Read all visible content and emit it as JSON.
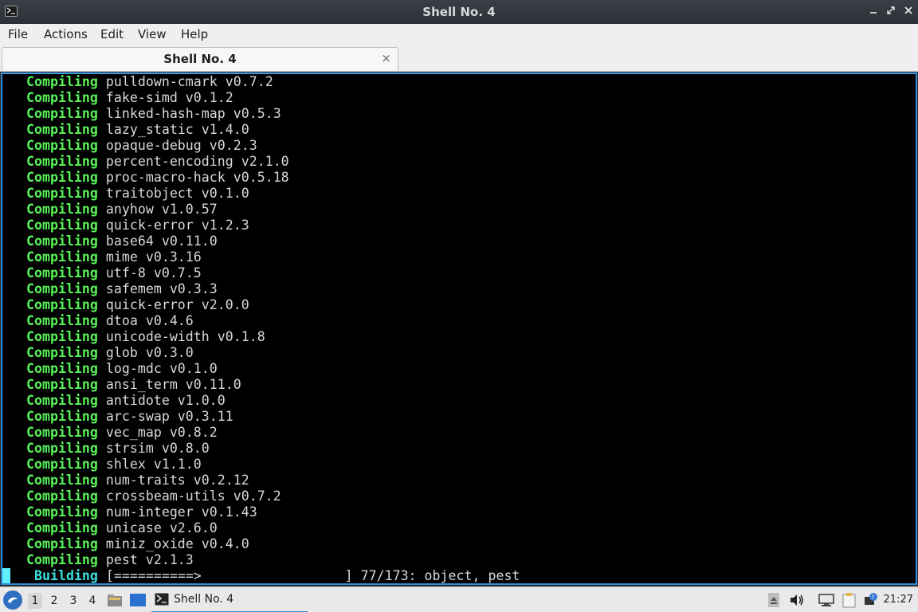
{
  "window": {
    "title": "Shell No. 4",
    "controls": [
      "minimize-icon",
      "restore-icon",
      "close-icon"
    ]
  },
  "menu": {
    "items": [
      "File",
      "Actions",
      "Edit",
      "View",
      "Help"
    ]
  },
  "tab": {
    "label": "Shell No. 4",
    "close": "×"
  },
  "terminal": {
    "keyword": "Compiling",
    "lines": [
      "pulldown-cmark v0.7.2",
      "fake-simd v0.1.2",
      "linked-hash-map v0.5.3",
      "lazy_static v1.4.0",
      "opaque-debug v0.2.3",
      "percent-encoding v2.1.0",
      "proc-macro-hack v0.5.18",
      "traitobject v0.1.0",
      "anyhow v1.0.57",
      "quick-error v1.2.3",
      "base64 v0.11.0",
      "mime v0.3.16",
      "utf-8 v0.7.5",
      "safemem v0.3.3",
      "quick-error v2.0.0",
      "dtoa v0.4.6",
      "unicode-width v0.1.8",
      "glob v0.3.0",
      "log-mdc v0.1.0",
      "ansi_term v0.11.0",
      "antidote v1.0.0",
      "arc-swap v0.3.11",
      "vec_map v0.8.2",
      "strsim v0.8.0",
      "shlex v1.1.0",
      "num-traits v0.2.12",
      "crossbeam-utils v0.7.2",
      "num-integer v0.1.43",
      "unicase v2.6.0",
      "miniz_oxide v0.4.0",
      "pest v2.1.3"
    ],
    "status": {
      "keyword": "Building",
      "bar": "[==========>                  ]",
      "progress": "77/173: object, pest"
    }
  },
  "taskbar": {
    "desktops": [
      "1",
      "2",
      "3",
      "4"
    ],
    "active_desktop": "1",
    "task_label": "Shell No. 4",
    "clock": "21:27"
  }
}
